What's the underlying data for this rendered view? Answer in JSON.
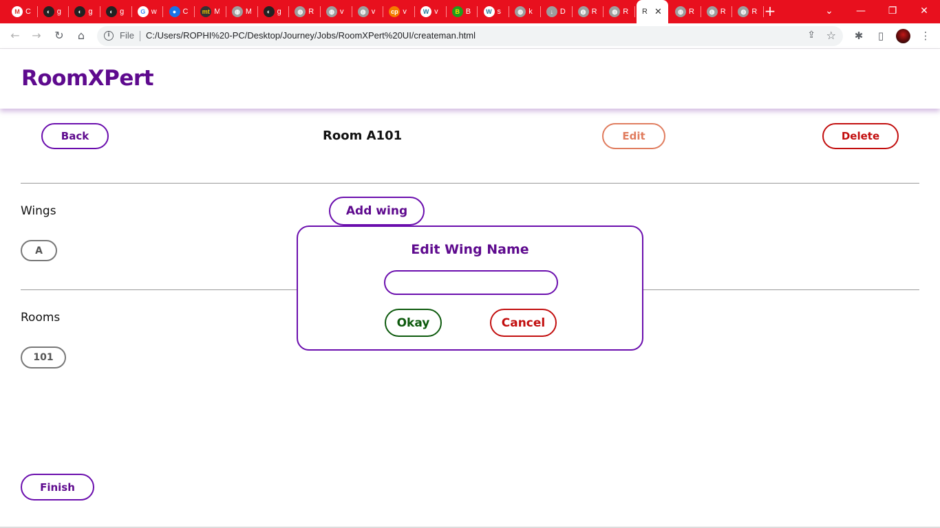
{
  "browser": {
    "tabs": [
      {
        "icon": "gmail-icon",
        "color": "#ffffff",
        "fg": "#d93025",
        "glyph": "M",
        "label": "C"
      },
      {
        "icon": "github-icon",
        "color": "#222222",
        "fg": "#ffffff",
        "glyph": "◐",
        "label": "g"
      },
      {
        "icon": "github-icon",
        "color": "#222222",
        "fg": "#ffffff",
        "glyph": "◐",
        "label": "g"
      },
      {
        "icon": "github-icon",
        "color": "#222222",
        "fg": "#ffffff",
        "glyph": "◐",
        "label": "g"
      },
      {
        "icon": "google-icon",
        "color": "#ffffff",
        "fg": "#4285f4",
        "glyph": "G",
        "label": "w"
      },
      {
        "icon": "chrome-web-icon",
        "color": "#1a73e8",
        "fg": "#ffffff",
        "glyph": "●",
        "label": "C"
      },
      {
        "icon": "mt-icon",
        "color": "#333333",
        "fg": "#f2c200",
        "glyph": "mt",
        "label": "M"
      },
      {
        "icon": "globe-icon",
        "color": "#9e9e9e",
        "fg": "#ffffff",
        "glyph": "◍",
        "label": "M"
      },
      {
        "icon": "github-icon",
        "color": "#222222",
        "fg": "#ffffff",
        "glyph": "◐",
        "label": "g"
      },
      {
        "icon": "globe-icon",
        "color": "#9e9e9e",
        "fg": "#ffffff",
        "glyph": "◍",
        "label": "R"
      },
      {
        "icon": "globe-icon",
        "color": "#9e9e9e",
        "fg": "#ffffff",
        "glyph": "◍",
        "label": "v"
      },
      {
        "icon": "globe-icon",
        "color": "#9e9e9e",
        "fg": "#ffffff",
        "glyph": "◍",
        "label": "v"
      },
      {
        "icon": "cp-icon",
        "color": "#f57c00",
        "fg": "#ffffff",
        "glyph": "cp",
        "label": "v"
      },
      {
        "icon": "wordpress-icon",
        "color": "#ffffff",
        "fg": "#21759b",
        "glyph": "W",
        "label": "v"
      },
      {
        "icon": "b-icon",
        "color": "#1e9e1e",
        "fg": "#ffe100",
        "glyph": "B",
        "label": "B"
      },
      {
        "icon": "wordpress-icon",
        "color": "#ffffff",
        "fg": "#21759b",
        "glyph": "W",
        "label": "s"
      },
      {
        "icon": "globe-icon",
        "color": "#9e9e9e",
        "fg": "#ffffff",
        "glyph": "◍",
        "label": "k"
      },
      {
        "icon": "download-icon",
        "color": "#9e9e9e",
        "fg": "#ffffff",
        "glyph": "↓",
        "label": "D"
      },
      {
        "icon": "globe-icon",
        "color": "#9e9e9e",
        "fg": "#ffffff",
        "glyph": "◍",
        "label": "R"
      },
      {
        "icon": "globe-icon",
        "color": "#9e9e9e",
        "fg": "#ffffff",
        "glyph": "◍",
        "label": "R"
      }
    ],
    "active_tab": {
      "label": "R",
      "close": "✕"
    },
    "tabs_after": [
      {
        "icon": "globe-icon",
        "color": "#9e9e9e",
        "fg": "#ffffff",
        "glyph": "◍",
        "label": "R"
      },
      {
        "icon": "globe-icon",
        "color": "#9e9e9e",
        "fg": "#ffffff",
        "glyph": "◍",
        "label": "R"
      },
      {
        "icon": "globe-icon",
        "color": "#9e9e9e",
        "fg": "#ffffff",
        "glyph": "◍",
        "label": "R"
      }
    ],
    "new_tab": "+",
    "window_controls": {
      "dropdown": "⌄",
      "minimize": "—",
      "restore": "❐",
      "close": "✕"
    },
    "nav": {
      "back": "←",
      "forward": "→",
      "reload": "↻",
      "home": "⌂"
    },
    "address": {
      "info": "i",
      "scheme_label": "File",
      "url": "C:/Users/ROPHI%20-PC/Desktop/Journey/Jobs/RoomXPert%20UI/createman.html",
      "share": "⇪",
      "star": "☆"
    },
    "toolbar_icons": {
      "extensions": "✱",
      "side_panel": "▯",
      "menu": "⋮"
    }
  },
  "app": {
    "brand": "RoomXPert",
    "back_label": "Back",
    "room_title": "Room A101",
    "edit_label": "Edit",
    "delete_label": "Delete",
    "wings_label": "Wings",
    "add_wing_label": "Add wing",
    "wings": [
      "A"
    ],
    "rooms_label": "Rooms",
    "rooms": [
      "101"
    ],
    "finish_label": "Finish"
  },
  "modal": {
    "title": "Edit Wing Name",
    "input_value": "",
    "input_placeholder": "",
    "okay_label": "Okay",
    "cancel_label": "Cancel"
  },
  "colors": {
    "brand": "#5e0a8e",
    "tabstrip": "#e8101e",
    "okay": "#0d5a0d",
    "danger": "#c20e0e",
    "edit": "#e07c5e"
  }
}
